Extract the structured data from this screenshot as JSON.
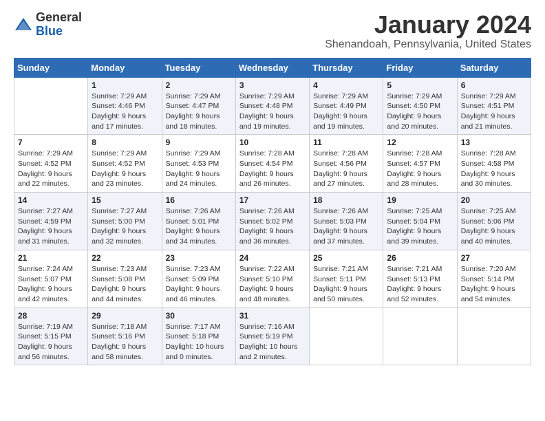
{
  "header": {
    "logo_general": "General",
    "logo_blue": "Blue",
    "month_title": "January 2024",
    "location": "Shenandoah, Pennsylvania, United States"
  },
  "days_of_week": [
    "Sunday",
    "Monday",
    "Tuesday",
    "Wednesday",
    "Thursday",
    "Friday",
    "Saturday"
  ],
  "weeks": [
    [
      {
        "num": "",
        "info": ""
      },
      {
        "num": "1",
        "info": "Sunrise: 7:29 AM\nSunset: 4:46 PM\nDaylight: 9 hours\nand 17 minutes."
      },
      {
        "num": "2",
        "info": "Sunrise: 7:29 AM\nSunset: 4:47 PM\nDaylight: 9 hours\nand 18 minutes."
      },
      {
        "num": "3",
        "info": "Sunrise: 7:29 AM\nSunset: 4:48 PM\nDaylight: 9 hours\nand 19 minutes."
      },
      {
        "num": "4",
        "info": "Sunrise: 7:29 AM\nSunset: 4:49 PM\nDaylight: 9 hours\nand 19 minutes."
      },
      {
        "num": "5",
        "info": "Sunrise: 7:29 AM\nSunset: 4:50 PM\nDaylight: 9 hours\nand 20 minutes."
      },
      {
        "num": "6",
        "info": "Sunrise: 7:29 AM\nSunset: 4:51 PM\nDaylight: 9 hours\nand 21 minutes."
      }
    ],
    [
      {
        "num": "7",
        "info": "Sunrise: 7:29 AM\nSunset: 4:52 PM\nDaylight: 9 hours\nand 22 minutes."
      },
      {
        "num": "8",
        "info": "Sunrise: 7:29 AM\nSunset: 4:52 PM\nDaylight: 9 hours\nand 23 minutes."
      },
      {
        "num": "9",
        "info": "Sunrise: 7:29 AM\nSunset: 4:53 PM\nDaylight: 9 hours\nand 24 minutes."
      },
      {
        "num": "10",
        "info": "Sunrise: 7:28 AM\nSunset: 4:54 PM\nDaylight: 9 hours\nand 26 minutes."
      },
      {
        "num": "11",
        "info": "Sunrise: 7:28 AM\nSunset: 4:56 PM\nDaylight: 9 hours\nand 27 minutes."
      },
      {
        "num": "12",
        "info": "Sunrise: 7:28 AM\nSunset: 4:57 PM\nDaylight: 9 hours\nand 28 minutes."
      },
      {
        "num": "13",
        "info": "Sunrise: 7:28 AM\nSunset: 4:58 PM\nDaylight: 9 hours\nand 30 minutes."
      }
    ],
    [
      {
        "num": "14",
        "info": "Sunrise: 7:27 AM\nSunset: 4:59 PM\nDaylight: 9 hours\nand 31 minutes."
      },
      {
        "num": "15",
        "info": "Sunrise: 7:27 AM\nSunset: 5:00 PM\nDaylight: 9 hours\nand 32 minutes."
      },
      {
        "num": "16",
        "info": "Sunrise: 7:26 AM\nSunset: 5:01 PM\nDaylight: 9 hours\nand 34 minutes."
      },
      {
        "num": "17",
        "info": "Sunrise: 7:26 AM\nSunset: 5:02 PM\nDaylight: 9 hours\nand 36 minutes."
      },
      {
        "num": "18",
        "info": "Sunrise: 7:26 AM\nSunset: 5:03 PM\nDaylight: 9 hours\nand 37 minutes."
      },
      {
        "num": "19",
        "info": "Sunrise: 7:25 AM\nSunset: 5:04 PM\nDaylight: 9 hours\nand 39 minutes."
      },
      {
        "num": "20",
        "info": "Sunrise: 7:25 AM\nSunset: 5:06 PM\nDaylight: 9 hours\nand 40 minutes."
      }
    ],
    [
      {
        "num": "21",
        "info": "Sunrise: 7:24 AM\nSunset: 5:07 PM\nDaylight: 9 hours\nand 42 minutes."
      },
      {
        "num": "22",
        "info": "Sunrise: 7:23 AM\nSunset: 5:08 PM\nDaylight: 9 hours\nand 44 minutes."
      },
      {
        "num": "23",
        "info": "Sunrise: 7:23 AM\nSunset: 5:09 PM\nDaylight: 9 hours\nand 46 minutes."
      },
      {
        "num": "24",
        "info": "Sunrise: 7:22 AM\nSunset: 5:10 PM\nDaylight: 9 hours\nand 48 minutes."
      },
      {
        "num": "25",
        "info": "Sunrise: 7:21 AM\nSunset: 5:11 PM\nDaylight: 9 hours\nand 50 minutes."
      },
      {
        "num": "26",
        "info": "Sunrise: 7:21 AM\nSunset: 5:13 PM\nDaylight: 9 hours\nand 52 minutes."
      },
      {
        "num": "27",
        "info": "Sunrise: 7:20 AM\nSunset: 5:14 PM\nDaylight: 9 hours\nand 54 minutes."
      }
    ],
    [
      {
        "num": "28",
        "info": "Sunrise: 7:19 AM\nSunset: 5:15 PM\nDaylight: 9 hours\nand 56 minutes."
      },
      {
        "num": "29",
        "info": "Sunrise: 7:18 AM\nSunset: 5:16 PM\nDaylight: 9 hours\nand 58 minutes."
      },
      {
        "num": "30",
        "info": "Sunrise: 7:17 AM\nSunset: 5:18 PM\nDaylight: 10 hours\nand 0 minutes."
      },
      {
        "num": "31",
        "info": "Sunrise: 7:16 AM\nSunset: 5:19 PM\nDaylight: 10 hours\nand 2 minutes."
      },
      {
        "num": "",
        "info": ""
      },
      {
        "num": "",
        "info": ""
      },
      {
        "num": "",
        "info": ""
      }
    ]
  ]
}
